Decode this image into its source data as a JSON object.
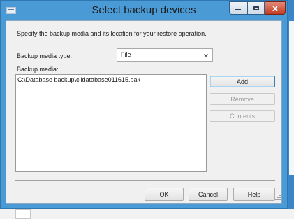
{
  "window": {
    "title": "Select backup devices",
    "close_glyph": "x"
  },
  "instruction_text": "Specify the backup media and its location for your restore operation.",
  "media_type": {
    "label": "Backup media type:",
    "selected_value": "File"
  },
  "media_list": {
    "label": "Backup media:",
    "items": [
      "C:\\Database backup\\clidatabase011615.bak"
    ]
  },
  "side_buttons": {
    "add": "Add",
    "remove": "Remove",
    "contents": "Contents"
  },
  "footer_buttons": {
    "ok": "OK",
    "cancel": "Cancel",
    "help": "Help"
  },
  "icons": {
    "window_icon": "window-app-icon",
    "minimize": "minimize-icon",
    "maximize": "maximize-icon",
    "close": "close-icon",
    "dropdown": "chevron-down-icon",
    "size_grip": "resize-grip-icon"
  },
  "colors": {
    "titlebar": "#4a9ad6",
    "close_button": "#c23b22",
    "dialog_background": "#f0f0f0",
    "default_button_border": "#3c7fb1"
  }
}
